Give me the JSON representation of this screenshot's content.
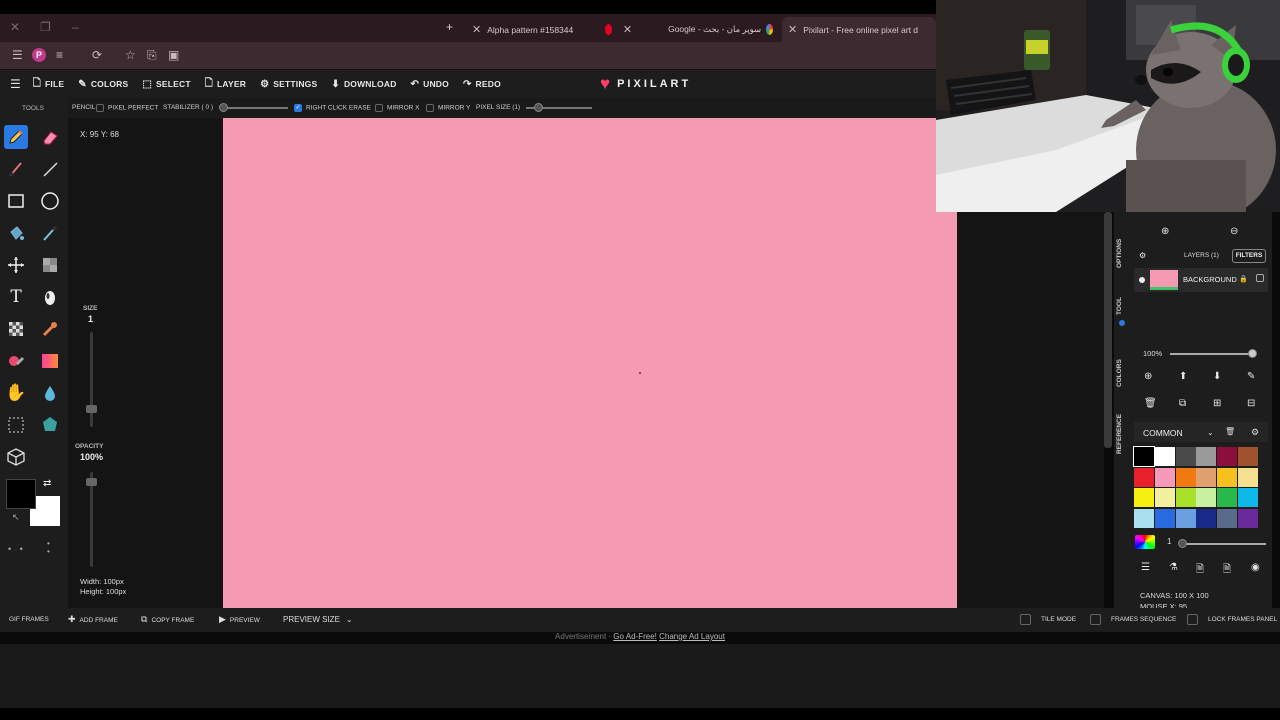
{
  "browser": {
    "tabs": [
      {
        "label": "Alpha pattern #158344"
      },
      {
        "label": "Google - سوپر مان - بحث"
      },
      {
        "label": "Pixilart - Free online pixel art d"
      }
    ],
    "profile_initial": "P"
  },
  "app": {
    "logo": "PIXILART",
    "menu": [
      "FILE",
      "COLORS",
      "SELECT",
      "LAYER",
      "SETTINGS",
      "DOWNLOAD",
      "UNDO",
      "REDO"
    ],
    "options": {
      "tool": "PENCIL",
      "pixel_perfect": "PIXEL PERFECT",
      "stabilizer": "STABILIZER ( 0 )",
      "right_click_erase": "RIGHT CLICK ERASE",
      "mirror_x": "MIRROR X",
      "mirror_y": "MIRROR Y",
      "pixel_size": "PIXEL SIZE (1)"
    },
    "tools_label": "TOOLS",
    "coords": "X: 95 Y: 68",
    "size_label": "SIZE",
    "size_value": "1",
    "opacity_label": "OPACITY",
    "opacity_value": "100%",
    "width_text": "Width: 100px",
    "height_text": "Height: 100px",
    "canvas_color": "#f49ab2",
    "accent": "#2a7ae2"
  },
  "right_panel": {
    "side_tabs": [
      "OPTIONS",
      "TOOL",
      "COLORS",
      "REFERENCE"
    ],
    "layers_label": "LAYERS (1)",
    "filters_label": "FILTERS",
    "layer_name": "BACKGROUND",
    "opacity": "100%",
    "palette_name": "COMMON",
    "brush_value": "1",
    "canvas_text": "CANVAS: 100 X 100",
    "mouse_text": "MOUSE X: 95",
    "swatches": [
      "#000000",
      "#ffffff",
      "#4a4a4a",
      "#9a9a9a",
      "#8b0f3a",
      "#a0522d",
      "#e8202a",
      "#f59ab8",
      "#f07a10",
      "#e0a070",
      "#f5c020",
      "#f5e090",
      "#f5f010",
      "#f0f0a0",
      "#a8e02a",
      "#c8f0a0",
      "#2ab84a",
      "#10b8e8",
      "#a8e0f0",
      "#2a6ae0",
      "#6aa0e0",
      "#1a2a8a",
      "#5a6a8a",
      "#6a2a9a"
    ]
  },
  "frames_bar": {
    "gif_frames": "GIF FRAMES",
    "add_frame": "ADD FRAME",
    "copy_frame": "COPY FRAME",
    "preview": "PREVIEW",
    "preview_size": "PREVIEW SIZE",
    "tile_mode": "TILE MODE",
    "frames_sequence": "FRAMES SEQUENCE",
    "lock_frames": "LOCK FRAMES PANEL"
  },
  "ad": {
    "advertisement": "Advertisement · ",
    "go_ad_free": "Go Ad-Free!",
    "change_layout": "Change Ad Layout"
  }
}
